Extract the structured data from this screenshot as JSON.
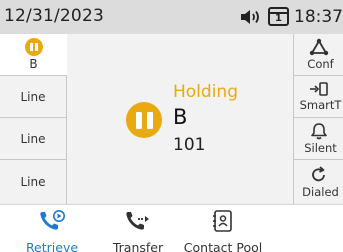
{
  "status_bar": {
    "date": "12/31/2023",
    "time": "18:37",
    "icons": [
      "speaker-icon",
      "line-number-icon"
    ],
    "line_number": "1"
  },
  "lines": [
    {
      "label": "B",
      "active": true,
      "icon": "hold-icon"
    },
    {
      "label": "Line"
    },
    {
      "label": "Line"
    },
    {
      "label": "Line"
    }
  ],
  "call": {
    "state": "Holding",
    "name": "B",
    "number": "101"
  },
  "right_keys": [
    {
      "label": "Conf",
      "icon": "conference-icon"
    },
    {
      "label": "SmartT",
      "icon": "smart-transfer-icon"
    },
    {
      "label": "Silent",
      "icon": "bell-icon"
    },
    {
      "label": "Dialed",
      "icon": "redial-icon"
    }
  ],
  "softkeys": [
    {
      "label": "Retrieve",
      "icon": "retrieve-call-icon"
    },
    {
      "label": "Transfer",
      "icon": "transfer-call-icon"
    },
    {
      "label": "Contact Pool",
      "icon": "contact-card-icon"
    }
  ],
  "colors": {
    "hold": "#e8aa10",
    "accent": "#1d7ad0",
    "status_bar": "#dcdcdc",
    "panel": "#f2f2f2"
  }
}
